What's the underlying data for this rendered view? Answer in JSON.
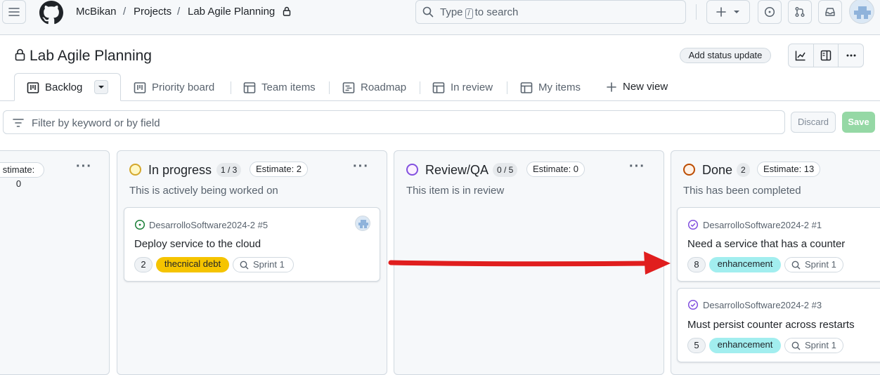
{
  "header": {
    "owner": "McBikan",
    "projects": "Projects",
    "project": "Lab Agile Planning",
    "sep": "/",
    "search_type": "Type",
    "search_key": "/",
    "search_rest": "to search"
  },
  "project": {
    "title": "Lab Agile Planning",
    "status_update": "Add status update"
  },
  "tabs": {
    "backlog": "Backlog",
    "priority_board": "Priority board",
    "team_items": "Team items",
    "roadmap": "Roadmap",
    "in_review": "In review",
    "my_items": "My items",
    "new_view": "New view"
  },
  "filter": {
    "placeholder": "Filter by keyword or by field",
    "discard": "Discard",
    "save": "Save"
  },
  "columns": [
    {
      "estimate": "stimate: 0"
    },
    {
      "title": "In progress",
      "count": "1 / 3",
      "estimate": "Estimate: 2",
      "description": "This is actively being worked on",
      "status_color": "#d4a72c"
    },
    {
      "title": "Review/QA",
      "count": "0 / 5",
      "estimate": "Estimate: 0",
      "description": "This item is in review",
      "status_color": "#8250df"
    },
    {
      "title": "Done",
      "count": "2",
      "estimate": "Estimate: 13",
      "description": "This has been completed",
      "status_color": "#bc4c00"
    }
  ],
  "cards": [
    {
      "repo": "DesarrolloSoftware2024-2 #5",
      "title": "Deploy service to the cloud",
      "points": "2",
      "label": "thecnical debt",
      "label_color": "#f5c400",
      "sprint": "Sprint 1"
    },
    {
      "repo": "DesarrolloSoftware2024-2 #1",
      "title": "Need a service that has a counter",
      "points": "8",
      "label": "enhancement",
      "label_color": "#a2eeef",
      "sprint": "Sprint 1"
    },
    {
      "repo": "DesarrolloSoftware2024-2 #3",
      "title": "Must persist counter across restarts",
      "points": "5",
      "label": "enhancement",
      "label_color": "#a2eeef",
      "sprint": "Sprint 1"
    }
  ],
  "colors": {
    "arrow": "#e01e1e",
    "open_issue": "#1a7f37",
    "closed_issue": "#8250df"
  }
}
